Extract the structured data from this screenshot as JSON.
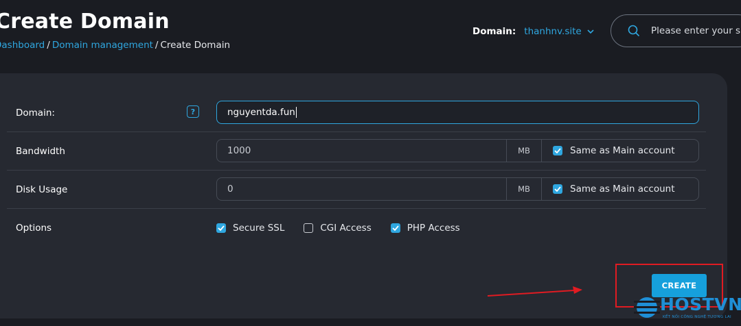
{
  "header": {
    "title": "Create Domain",
    "breadcrumb": [
      "Dashboard",
      "Domain management",
      "Create Domain"
    ],
    "domain_label": "Domain:",
    "domain_value": "thanhnv.site",
    "search_placeholder": "Please enter your s"
  },
  "form": {
    "domain": {
      "label": "Domain:",
      "help": "?",
      "value": "nguyentda.fun"
    },
    "bandwidth": {
      "label": "Bandwidth",
      "value": "1000",
      "unit": "MB",
      "same_label": "Same as Main account",
      "same_checked": true
    },
    "disk_usage": {
      "label": "Disk Usage",
      "value": "0",
      "unit": "MB",
      "same_label": "Same as Main account",
      "same_checked": true
    },
    "options": {
      "label": "Options",
      "items": [
        {
          "label": "Secure SSL",
          "checked": true
        },
        {
          "label": "CGI Access",
          "checked": false
        },
        {
          "label": "PHP Access",
          "checked": true
        }
      ]
    }
  },
  "create_button": "CREATE",
  "watermark": {
    "brand": "HOSTVN",
    "tagline": "KẾT NỐI CÔNG NGHỆ TƯƠNG LAI"
  },
  "colors": {
    "accent": "#2fa7e0",
    "button": "#16a0dc",
    "highlight": "#e11b22",
    "panel": "#262931",
    "background": "#1a1c22"
  }
}
